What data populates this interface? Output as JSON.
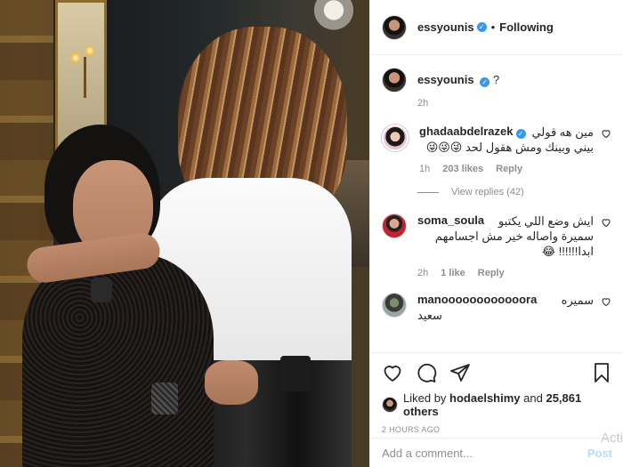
{
  "header": {
    "username": "essyounis",
    "separator": "•",
    "follow_status": "Following"
  },
  "caption": {
    "username": "essyounis",
    "text": "?‬",
    "time": "2h"
  },
  "comments": [
    {
      "username": "ghadaabdelrazek",
      "verified": true,
      "text_line1": "مين هه قولي",
      "text_line2": "بيني وبينك ومش هقول لحد 😜😜😜",
      "time": "1h",
      "likes": "203 likes",
      "reply": "Reply",
      "view_replies": "View replies (42)"
    },
    {
      "username": "soma_soula",
      "text_line1": "ايش وضع اللي يكتبو",
      "text_line2": "سميرة واصاله خير مش اجسامهم",
      "text_line3": "ابدا!!!!!! 😂",
      "time": "2h",
      "likes": "1 like",
      "reply": "Reply"
    },
    {
      "username": "manoooooooooooora",
      "text_line1": "سميره",
      "text_line2": "سعيد"
    }
  ],
  "actions": {
    "liked_by_prefix": "Liked by",
    "liked_by_user": "hodaelshimy",
    "liked_by_and": "and",
    "liked_by_others": "25,861 others",
    "time_ago": "2 HOURS AGO"
  },
  "add_comment": {
    "placeholder": "Add a comment...",
    "post_label": "Post"
  },
  "watermark": "Acti",
  "colors": {
    "verified": "#3897f0",
    "muted": "#8e8e8e",
    "text": "#262626",
    "post_disabled": "#b2dffc"
  }
}
